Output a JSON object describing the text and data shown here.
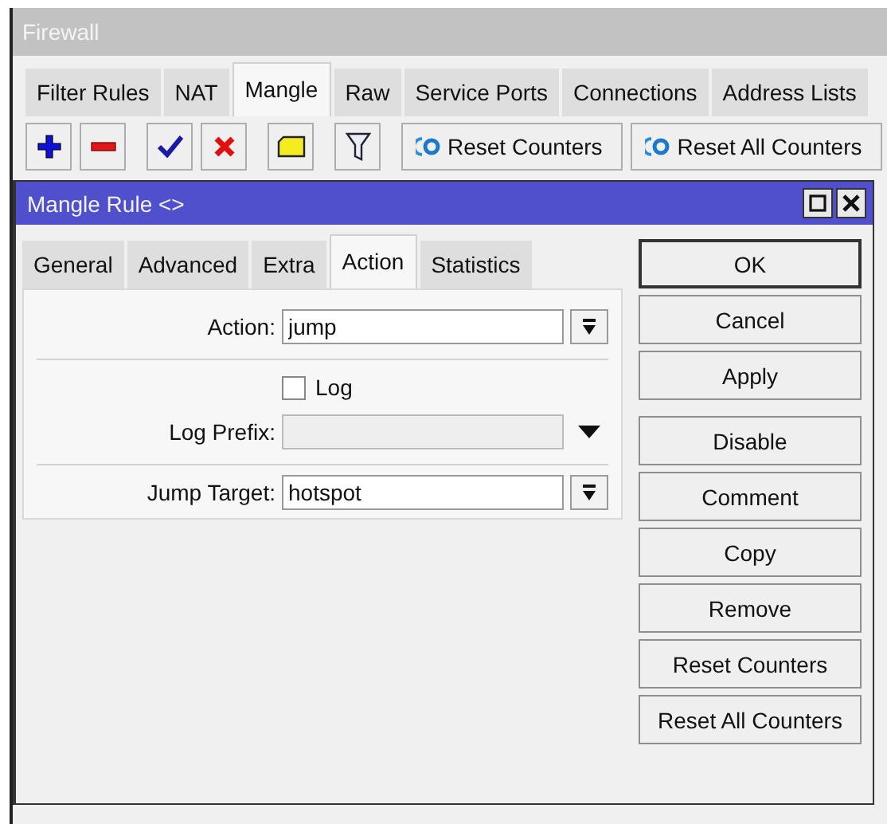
{
  "window": {
    "title": "Firewall"
  },
  "tabs": [
    {
      "label": "Filter Rules",
      "selected": false
    },
    {
      "label": "NAT",
      "selected": false
    },
    {
      "label": "Mangle",
      "selected": true
    },
    {
      "label": "Raw",
      "selected": false
    },
    {
      "label": "Service Ports",
      "selected": false
    },
    {
      "label": "Connections",
      "selected": false
    },
    {
      "label": "Address Lists",
      "selected": false
    }
  ],
  "toolbar": {
    "buttons": [
      "Reset Counters",
      "Reset All Counters"
    ]
  },
  "dialog": {
    "title": "Mangle Rule <>",
    "tabs": [
      {
        "label": "General",
        "selected": false
      },
      {
        "label": "Advanced",
        "selected": false
      },
      {
        "label": "Extra",
        "selected": false
      },
      {
        "label": "Action",
        "selected": true
      },
      {
        "label": "Statistics",
        "selected": false
      }
    ],
    "sections": [
      [
        {
          "kind": "select",
          "label": "Action:",
          "value": "jump",
          "disabled": false
        }
      ],
      [
        {
          "kind": "checkbox",
          "label": "Log",
          "checked": false
        },
        {
          "kind": "combo",
          "label": "Log Prefix:",
          "disabled": true
        }
      ],
      [
        {
          "kind": "select",
          "label": "Jump Target:",
          "value": "hotspot",
          "disabled": false
        }
      ]
    ],
    "button_groups": [
      [
        {
          "label": "OK",
          "default": true
        },
        {
          "label": "Cancel",
          "default": false
        },
        {
          "label": "Apply",
          "default": false
        }
      ],
      [
        {
          "label": "Disable",
          "default": false
        },
        {
          "label": "Comment",
          "default": false
        },
        {
          "label": "Copy",
          "default": false
        },
        {
          "label": "Remove",
          "default": false
        },
        {
          "label": "Reset Counters",
          "default": false
        },
        {
          "label": "Reset All Counters",
          "default": false
        }
      ]
    ]
  }
}
